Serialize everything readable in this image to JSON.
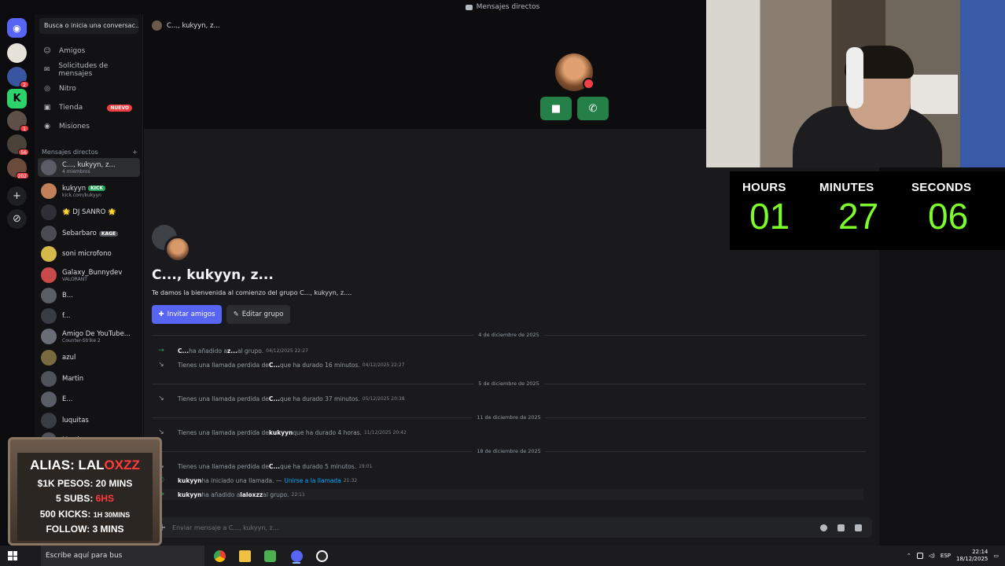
{
  "window": {
    "title": "Mensajes directos"
  },
  "rail": {
    "servers": [
      {
        "name": "discord-home-icon",
        "badge": ""
      },
      {
        "name": "server-1",
        "badge": ""
      },
      {
        "name": "server-2",
        "badge": "2"
      },
      {
        "name": "server-kick",
        "badge": ""
      },
      {
        "name": "server-4",
        "badge": "1"
      },
      {
        "name": "server-5",
        "badge": "56"
      },
      {
        "name": "server-6",
        "badge": "202"
      }
    ]
  },
  "sidebar": {
    "search_placeholder": "Busca o inicia una conversac...",
    "nav": [
      {
        "label": "Amigos",
        "icon": "friends-icon"
      },
      {
        "label": "Solicitudes de mensajes",
        "icon": "mail-icon"
      },
      {
        "label": "Nitro",
        "icon": "nitro-icon"
      },
      {
        "label": "Tienda",
        "icon": "shop-icon",
        "badge": "NUEVO"
      },
      {
        "label": "Misiones",
        "icon": "quests-icon"
      }
    ],
    "dm_header": "Mensajes directos",
    "dm_header_plus": "+",
    "dms": [
      {
        "name": "C..., kukyyn, z...",
        "sub": "4 miembros",
        "color": "#5a5d66",
        "active": true
      },
      {
        "name": "kukyyn",
        "tag": "KICK",
        "sub": "kick.com/kukyyn",
        "color": "#c0805a"
      },
      {
        "name": "🌟 DJ SANRO 🌟",
        "sub": "",
        "color": "#2f2f35"
      },
      {
        "name": "Sebarbaro",
        "tag": "KAGE",
        "sub": "",
        "color": "#4a4c52"
      },
      {
        "name": "soni microfono",
        "sub": "",
        "color": "#d4b84a"
      },
      {
        "name": "Galaxy_Bunnydev",
        "sub": "VALORANT",
        "color": "#c84a4a"
      },
      {
        "name": "B...",
        "sub": "",
        "color": "#5a5d66"
      },
      {
        "name": "f...",
        "sub": "",
        "color": "#3a3c43"
      },
      {
        "name": "Amigo De YouTube...",
        "sub": "Counter-Strike 2",
        "color": "#6a6d75"
      },
      {
        "name": "azul",
        "sub": "",
        "color": "#7a6a40"
      },
      {
        "name": "Martin",
        "sub": "",
        "color": "#50525a"
      },
      {
        "name": "E...",
        "sub": "",
        "color": "#5a5d66"
      },
      {
        "name": "luquitas",
        "sub": "",
        "color": "#3a3c43"
      },
      {
        "name": "Marti",
        "sub": "",
        "color": "#50525a"
      }
    ]
  },
  "main": {
    "channel_title": "C..., kukyyn, z...",
    "call_buttons": {
      "video": "video-icon",
      "call": "phone-icon"
    },
    "group_title": "C..., kukyyn, z...",
    "welcome": "Te damos la bienvenida al comienzo del grupo C..., kukyyn, z....",
    "invite_label": "Invitar amigos",
    "edit_label": "Editar grupo",
    "dividers": [
      "4 de diciembre de 2025",
      "5 de diciembre de 2025",
      "11 de diciembre de 2025",
      "18 de diciembre de 2025"
    ],
    "messages": [
      {
        "icon": "→",
        "kind": "join",
        "pre": "",
        "b1": "C...",
        "mid": " ha añadido a ",
        "b2": "z...",
        "post": " al grupo.",
        "ts": "04/12/2025 22:27",
        "link": ""
      },
      {
        "icon": "↘",
        "kind": "missed",
        "pre": "Tienes una llamada perdida de ",
        "b1": "C...",
        "mid": " que ha durado 16 minutos.",
        "b2": "",
        "post": "",
        "ts": "04/12/2025 22:27",
        "link": ""
      },
      {
        "icon": "↘",
        "kind": "missed",
        "pre": "Tienes una llamada perdida de ",
        "b1": "C...",
        "mid": " que ha durado 37 minutos.",
        "b2": "",
        "post": "",
        "ts": "05/12/2025 20:38",
        "link": ""
      },
      {
        "icon": "↘",
        "kind": "missed",
        "pre": "Tienes una llamada perdida de ",
        "b1": "kukyyn",
        "mid": " que ha durado 4 horas.",
        "b2": "",
        "post": "",
        "ts": "11/12/2025 20:42",
        "link": ""
      },
      {
        "icon": "↘",
        "kind": "missed",
        "pre": "Tienes una llamada perdida de ",
        "b1": "C...",
        "mid": " que ha durado 5 minutos.",
        "b2": "",
        "post": "",
        "ts": "19:01",
        "link": ""
      },
      {
        "icon": "✆",
        "kind": "call",
        "pre": "",
        "b1": "kukyyn",
        "mid": " ha iniciado una llamada. —",
        "b2": "",
        "post": "",
        "ts": "21:32",
        "link": "Unirse a la llamada"
      },
      {
        "icon": "→",
        "kind": "join",
        "pre": "",
        "b1": "kukyyn",
        "mid": " ha añadido a ",
        "b2": "laloxzz",
        "post": " al grupo.",
        "ts": "22:11",
        "link": ""
      }
    ],
    "composer_placeholder": "Enviar mensaje a C..., kukyyn, z..."
  },
  "timer": {
    "hours_label": "HOURS",
    "hours": "01",
    "minutes_label": "MINUTES",
    "minutes": "27",
    "seconds_label": "SECONDS",
    "seconds": "06"
  },
  "overlay": {
    "alias_prefix": "ALIAS: LAL",
    "alias_suffix": "OXZZ",
    "line1": "$1K PESOS: 20 MINS",
    "line2_prefix": "5 SUBS: ",
    "line2_suffix": "6HS",
    "line3_prefix": "500 KICKS: ",
    "line3_suffix": "1H 30MINS",
    "line4": "FOLLOW: 3 MINS"
  },
  "taskbar": {
    "search_placeholder": "Escribe aquí para bus",
    "lang": "ESP",
    "time": "22:14",
    "date": "18/12/2025"
  },
  "colors": {
    "accent": "#5865f2",
    "green": "#248046",
    "timer": "#7cfc2a"
  }
}
